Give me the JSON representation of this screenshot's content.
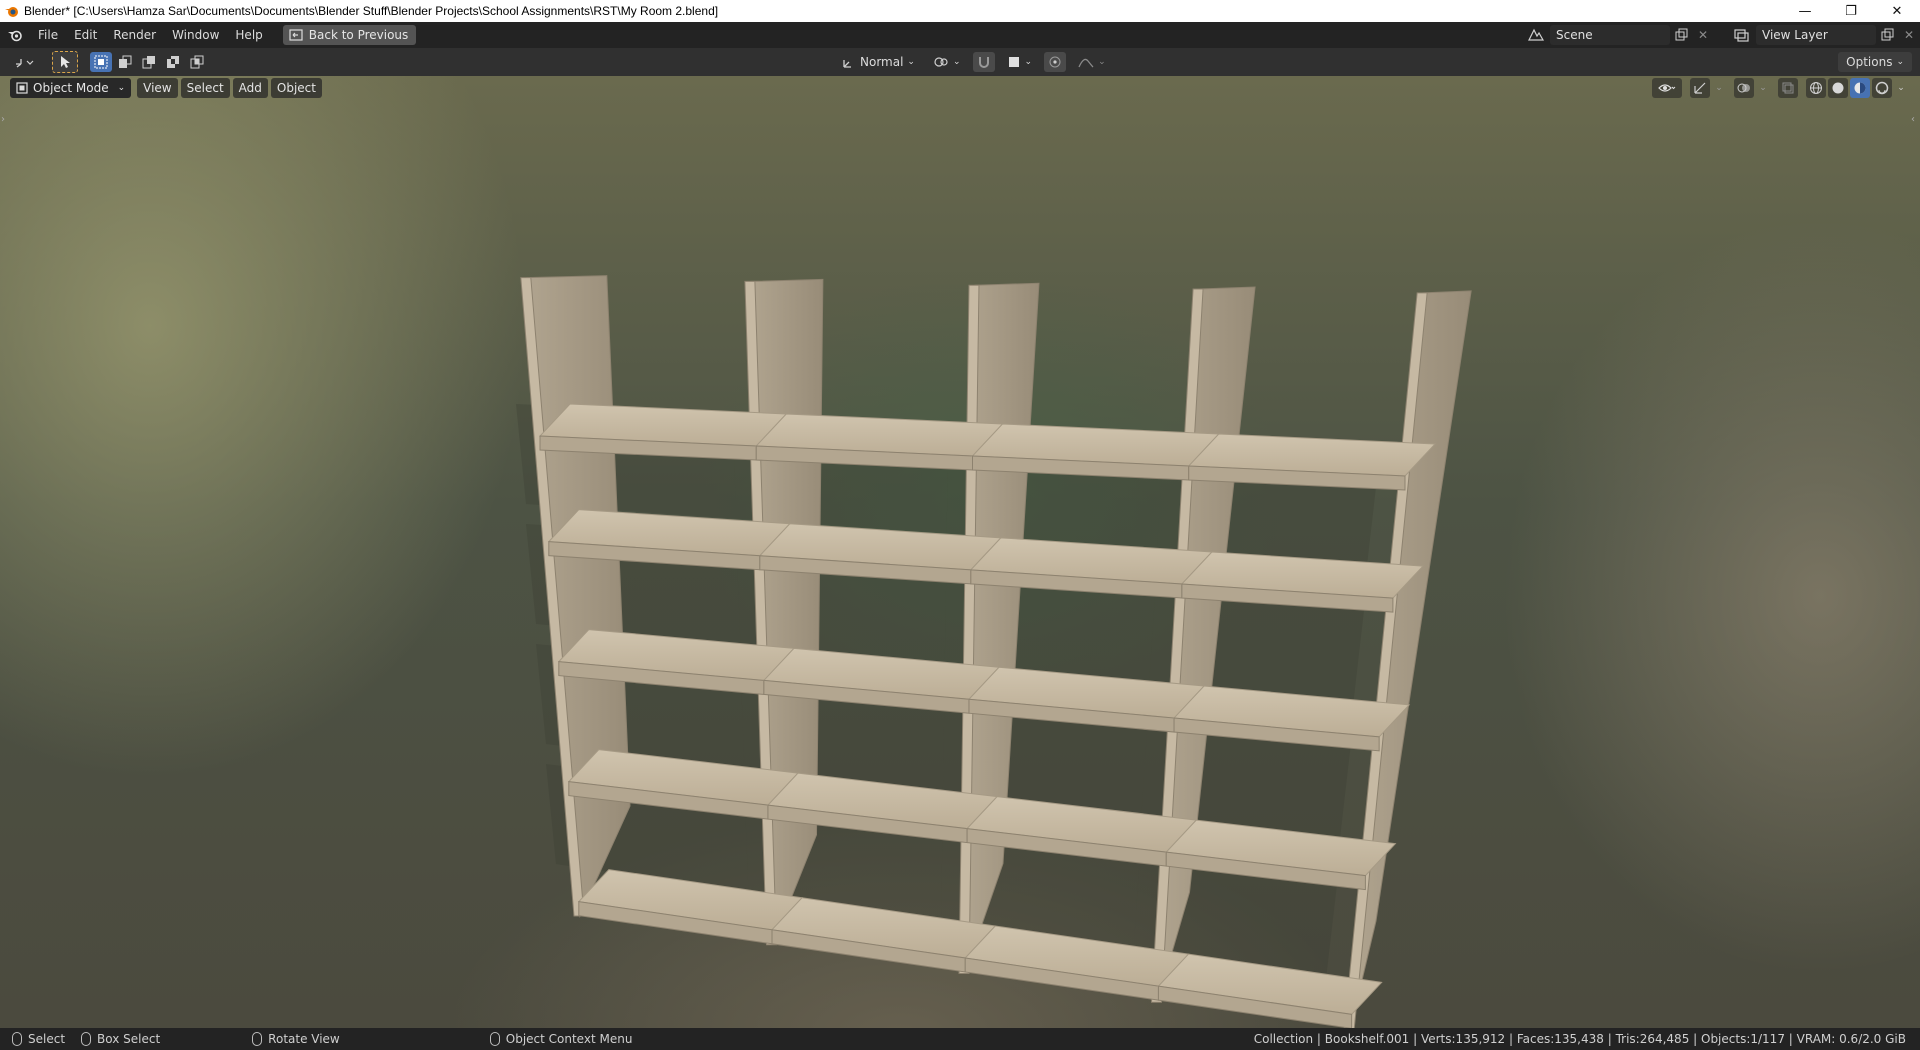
{
  "window": {
    "title": "Blender* [C:\\Users\\Hamza Sar\\Documents\\Documents\\Blender Stuff\\Blender Projects\\School Assignments\\RST\\My Room 2.blend]",
    "minimize_glyph": "—",
    "restore_glyph": "❐",
    "close_glyph": "✕"
  },
  "topbar": {
    "menus": [
      "File",
      "Edit",
      "Render",
      "Window",
      "Help"
    ],
    "back_button": "Back to Previous",
    "scene_name": "Scene",
    "view_layer_name": "View Layer"
  },
  "toolheader": {
    "orientation": "Normal",
    "options_label": "Options"
  },
  "viewport": {
    "mode": "Object Mode",
    "menus": [
      "View",
      "Select",
      "Add",
      "Object"
    ],
    "object": "Bookshelf.001"
  },
  "statusbar": {
    "select": "Select",
    "box_select": "Box Select",
    "rotate_view": "Rotate View",
    "context_menu": "Object Context Menu",
    "stats": "Collection | Bookshelf.001 | Verts:135,912 | Faces:135,438 | Tris:264,485 | Objects:1/117 | VRAM: 0.6/2.0 GiB"
  },
  "colors": {
    "accent": "#4772b3",
    "wood_light": "#c8bca8",
    "wood_shadow": "#9a8f7c"
  }
}
